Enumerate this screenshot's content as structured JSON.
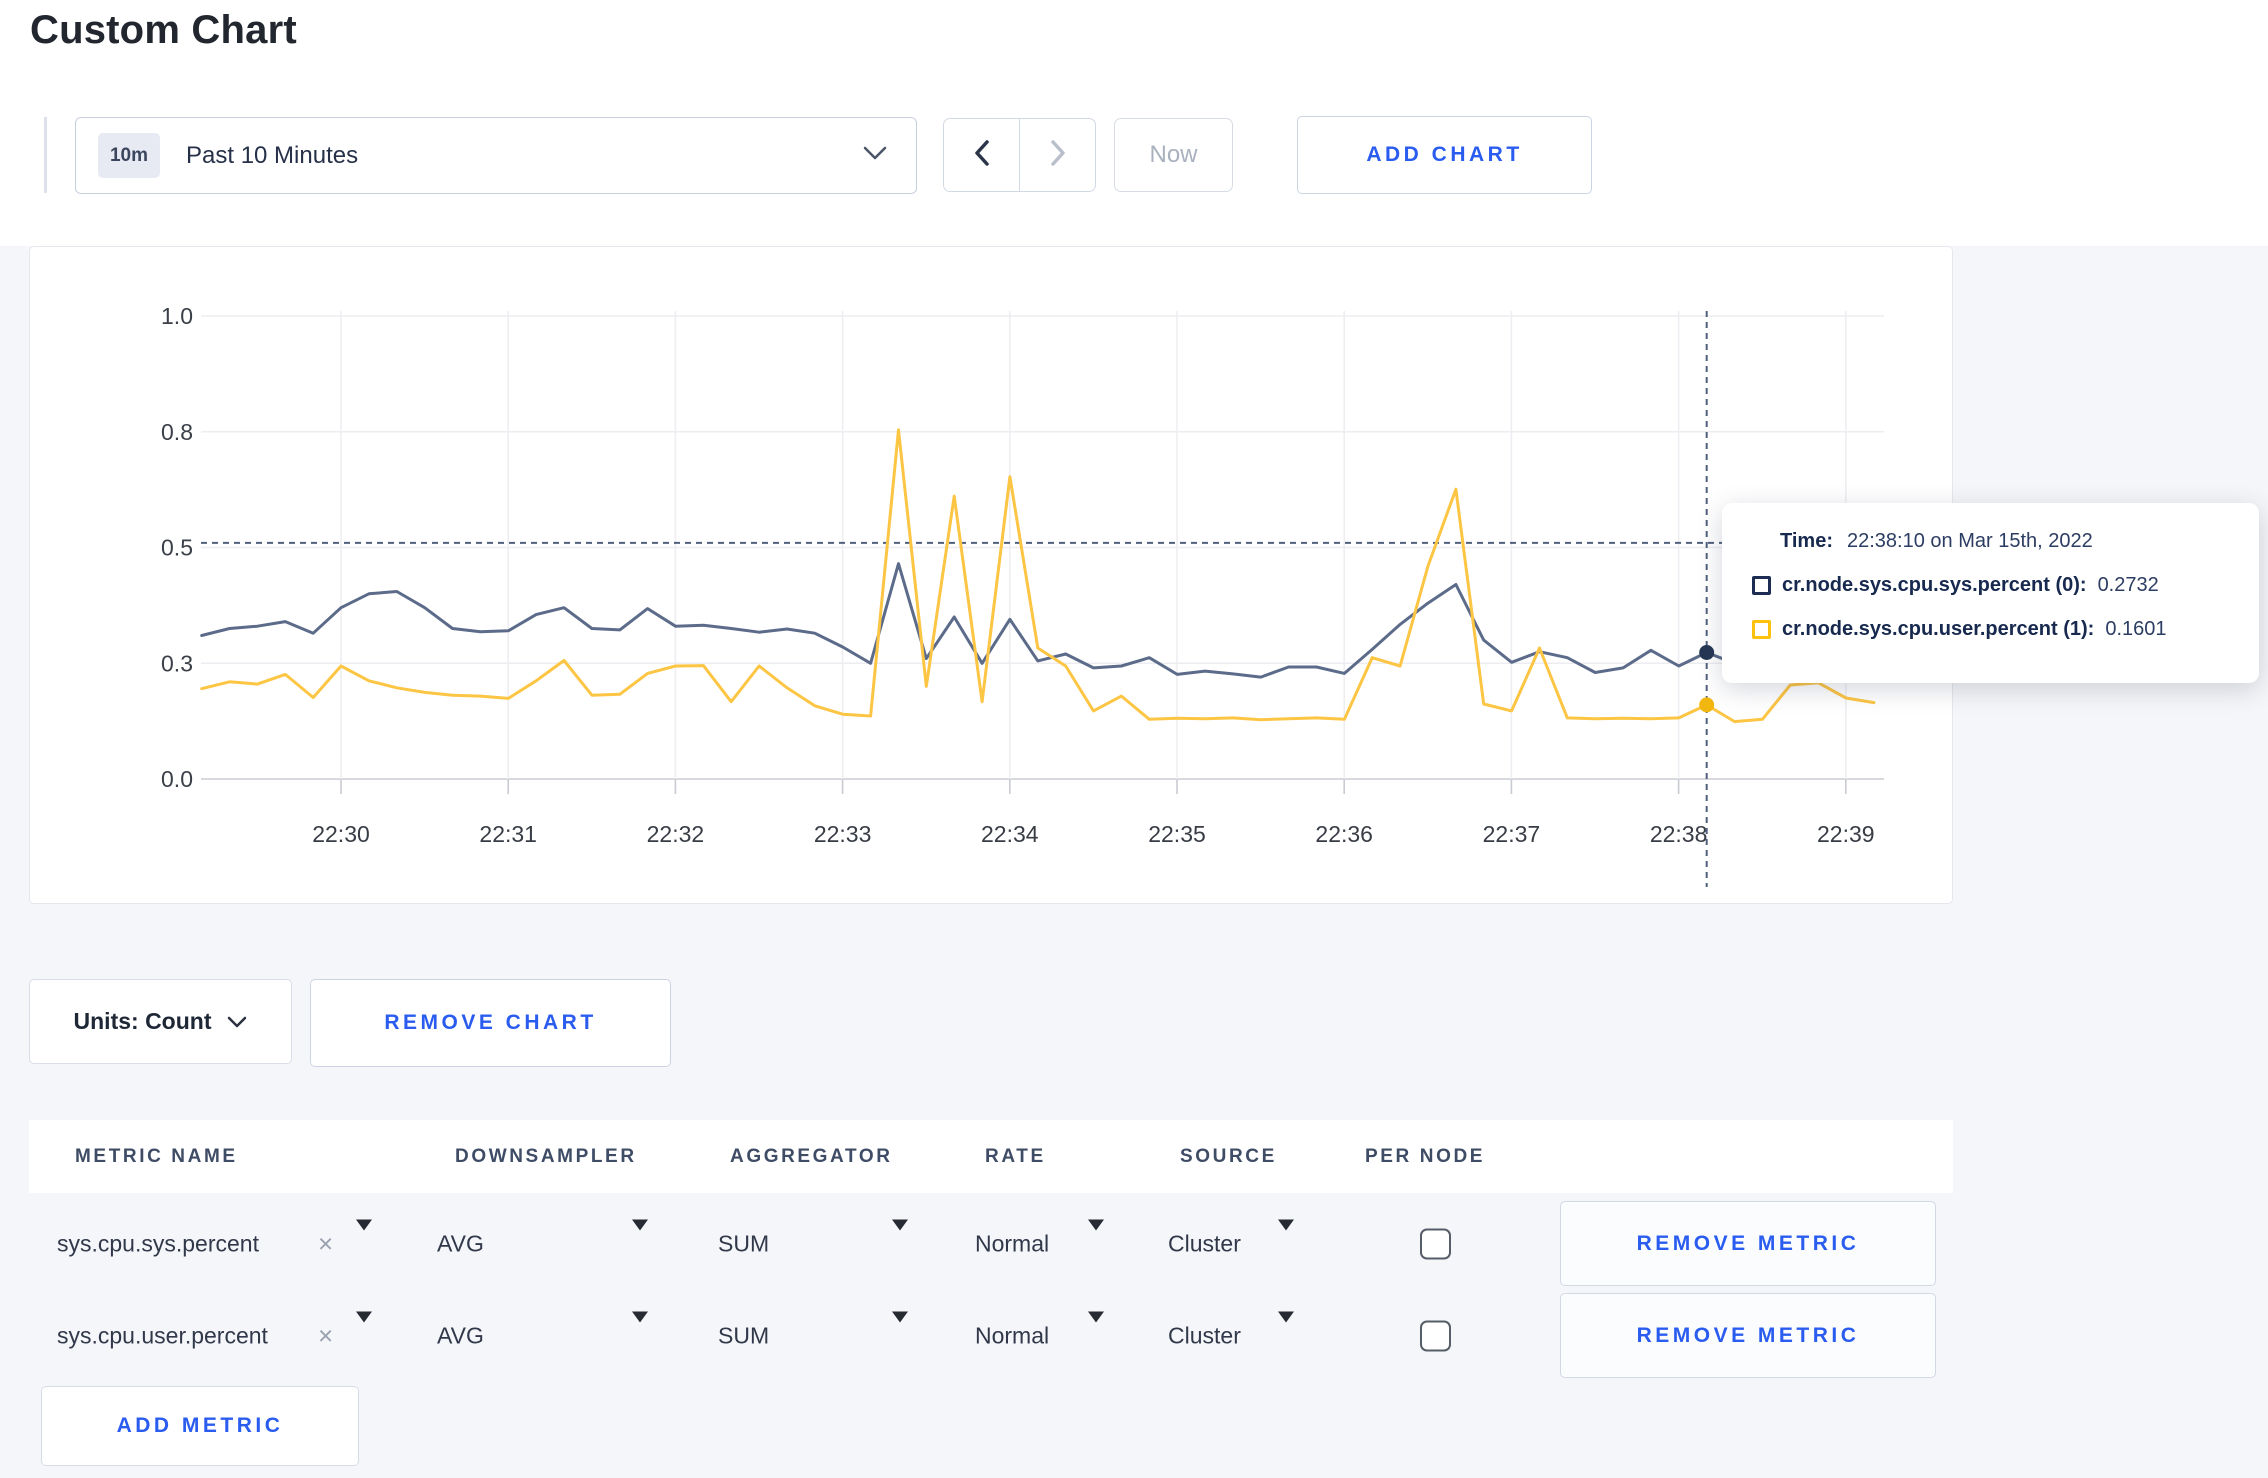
{
  "page": {
    "title": "Custom Chart"
  },
  "colors": {
    "accent_blue": "#2a5cf0",
    "page_gray": "#f5f6f9",
    "series_sys": "#5b6b89",
    "series_user": "#fcc544",
    "swatch_sys": "#1d2c52",
    "swatch_user": "#fdc20d",
    "crosshair": "#50607c"
  },
  "toolbar": {
    "time_range": {
      "badge": "10m",
      "label": "Past 10 Minutes"
    },
    "now_label": "Now",
    "add_chart_label": "ADD CHART"
  },
  "tooltip": {
    "time_label": "Time:",
    "time_value": "22:38:10 on Mar 15th, 2022",
    "entries": [
      {
        "label": "cr.node.sys.cpu.sys.percent (0):",
        "value": "0.2732"
      },
      {
        "label": "cr.node.sys.cpu.user.percent (1):",
        "value": "0.1601"
      }
    ]
  },
  "controls": {
    "units_label": "Units: Count",
    "remove_chart_label": "REMOVE CHART",
    "remove_metric_label": "REMOVE METRIC",
    "add_metric_label": "ADD METRIC"
  },
  "table": {
    "headers": [
      "METRIC NAME",
      "DOWNSAMPLER",
      "AGGREGATOR",
      "RATE",
      "SOURCE",
      "PER NODE"
    ],
    "rows": [
      {
        "metric": "sys.cpu.sys.percent",
        "downsampler": "AVG",
        "aggregator": "SUM",
        "rate": "Normal",
        "source": "Cluster",
        "per_node_checked": false
      },
      {
        "metric": "sys.cpu.user.percent",
        "downsampler": "AVG",
        "aggregator": "SUM",
        "rate": "Normal",
        "source": "Cluster",
        "per_node_checked": false
      }
    ]
  },
  "chart_data": {
    "type": "line",
    "title": "",
    "xlabel": "",
    "ylabel": "",
    "ylim": [
      0,
      1
    ],
    "grid": true,
    "x_ticks": [
      "22:30",
      "22:31",
      "22:32",
      "22:33",
      "22:34",
      "22:35",
      "22:36",
      "22:37",
      "22:38",
      "22:39"
    ],
    "y_ticks": [
      {
        "v": 0.0,
        "label": "0.0"
      },
      {
        "v": 0.25,
        "label": "0.3"
      },
      {
        "v": 0.5,
        "label": "0.5"
      },
      {
        "v": 0.75,
        "label": "0.8"
      },
      {
        "v": 1.0,
        "label": "1.0"
      }
    ],
    "start_time": "22:29:10",
    "interval_seconds": 10,
    "hover": {
      "index": 54,
      "time": "22:38:10 on Mar 15th, 2022",
      "y_line": 0.51
    },
    "series": [
      {
        "name": "cr.node.sys.cpu.sys.percent (0)",
        "color": "#5b6b89",
        "dot_color": "#253754",
        "values": [
          0.31,
          0.325,
          0.33,
          0.34,
          0.315,
          0.37,
          0.4,
          0.405,
          0.37,
          0.325,
          0.318,
          0.32,
          0.355,
          0.37,
          0.325,
          0.322,
          0.368,
          0.33,
          0.332,
          0.325,
          0.317,
          0.324,
          0.315,
          0.285,
          0.25,
          0.465,
          0.26,
          0.35,
          0.25,
          0.345,
          0.255,
          0.27,
          0.24,
          0.244,
          0.262,
          0.226,
          0.233,
          0.227,
          0.22,
          0.242,
          0.242,
          0.228,
          0.28,
          0.334,
          0.38,
          0.42,
          0.3,
          0.252,
          0.275,
          0.262,
          0.23,
          0.24,
          0.278,
          0.244,
          0.2732,
          0.25,
          0.27,
          0.3,
          0.31,
          0.295,
          0.3
        ]
      },
      {
        "name": "cr.node.sys.cpu.user.percent (1)",
        "color": "#fcc544",
        "dot_color": "#f2b70e",
        "values": [
          0.195,
          0.21,
          0.205,
          0.226,
          0.176,
          0.244,
          0.212,
          0.197,
          0.187,
          0.181,
          0.179,
          0.174,
          0.212,
          0.256,
          0.181,
          0.183,
          0.228,
          0.244,
          0.245,
          0.167,
          0.244,
          0.197,
          0.158,
          0.14,
          0.136,
          0.754,
          0.2,
          0.611,
          0.167,
          0.653,
          0.283,
          0.244,
          0.147,
          0.179,
          0.129,
          0.131,
          0.13,
          0.132,
          0.128,
          0.13,
          0.132,
          0.129,
          0.262,
          0.244,
          0.46,
          0.626,
          0.162,
          0.147,
          0.283,
          0.132,
          0.13,
          0.131,
          0.13,
          0.132,
          0.1601,
          0.124,
          0.129,
          0.203,
          0.208,
          0.175,
          0.165
        ]
      }
    ]
  }
}
